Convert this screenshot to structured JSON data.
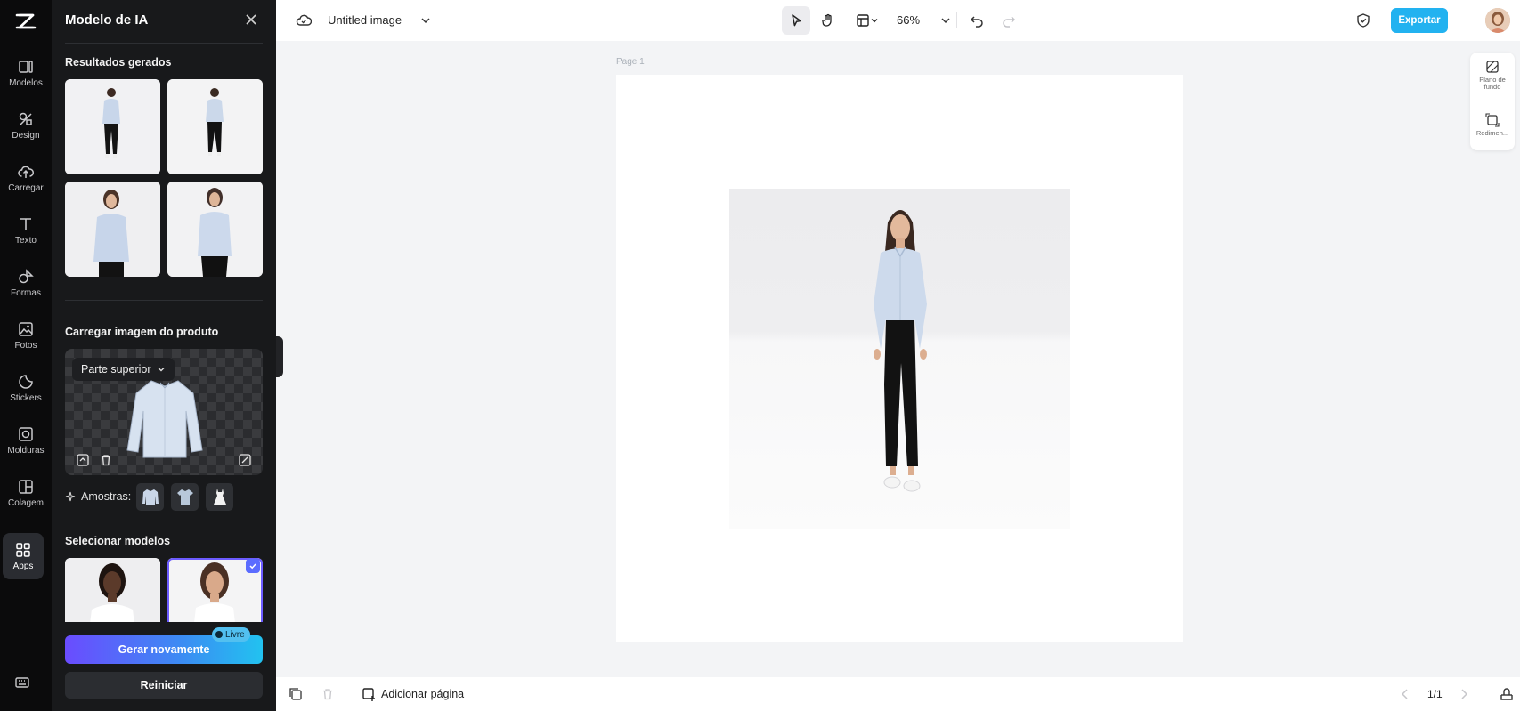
{
  "rail": {
    "items": [
      {
        "label": "Modelos",
        "icon": "templates-icon"
      },
      {
        "label": "Design",
        "icon": "design-icon"
      },
      {
        "label": "Carregar",
        "icon": "upload-cloud-icon"
      },
      {
        "label": "Texto",
        "icon": "text-icon"
      },
      {
        "label": "Formas",
        "icon": "shapes-icon"
      },
      {
        "label": "Fotos",
        "icon": "photos-icon"
      },
      {
        "label": "Stickers",
        "icon": "stickers-icon"
      },
      {
        "label": "Molduras",
        "icon": "frames-icon"
      },
      {
        "label": "Colagem",
        "icon": "collage-icon"
      },
      {
        "label": "Apps",
        "icon": "apps-grid-icon"
      }
    ],
    "active": "Apps"
  },
  "panel": {
    "title": "Modelo de IA",
    "results_heading": "Resultados gerados",
    "upload_heading": "Carregar imagem do produto",
    "category": "Parte superior",
    "samples_label": "Amostras:",
    "models_heading": "Selecionar modelos",
    "generate_label": "Gerar novamente",
    "free_badge": "Livre",
    "reset_label": "Reiniciar"
  },
  "topbar": {
    "doc_title": "Untitled image",
    "zoom": "66%",
    "export_label": "Exportar"
  },
  "canvas": {
    "page_label": "Page 1"
  },
  "right_panel": {
    "background_label": "Plano de fundo",
    "resize_label": "Redimen..."
  },
  "bottombar": {
    "add_page_label": "Adicionar página",
    "page_count": "1/1"
  },
  "colors": {
    "accent": "#22b2f0",
    "panel_bg": "#18191b",
    "rail_bg": "#0b0b0c",
    "generate_gradient_start": "#6a4cff",
    "generate_gradient_end": "#22c2f0",
    "selected_outline": "#6c5bff"
  }
}
